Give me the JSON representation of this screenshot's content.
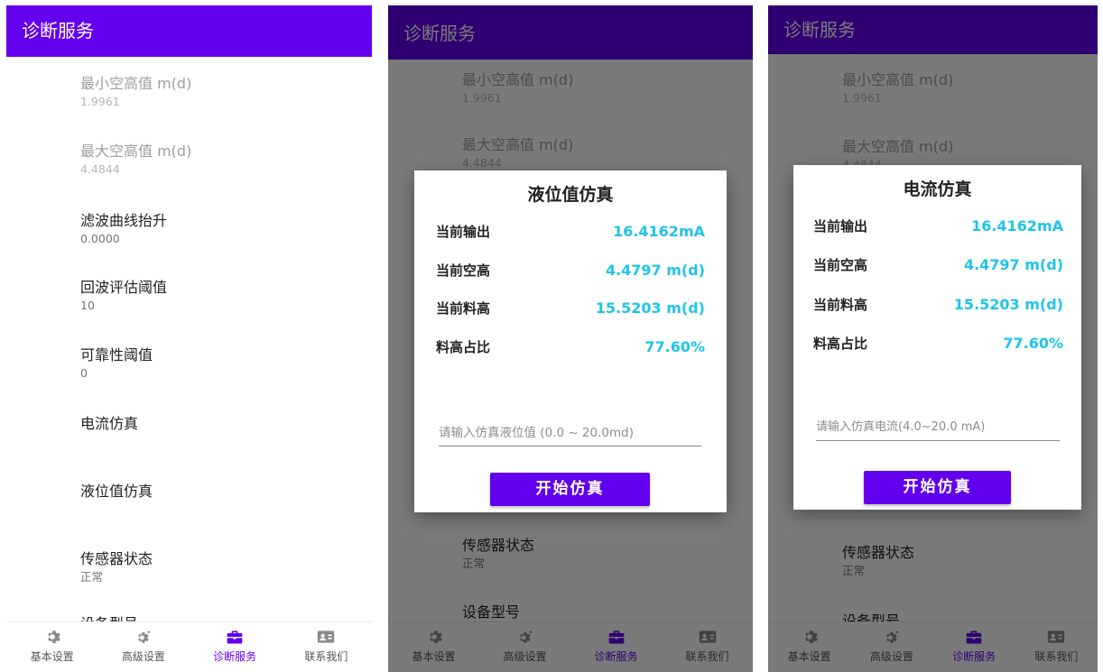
{
  "appbar": {
    "title": "诊断服务"
  },
  "settings": [
    {
      "title": "最小空高值 m(d)",
      "value": "1.9961"
    },
    {
      "title": "最大空高值 m(d)",
      "value": "4.4844"
    },
    {
      "title": "滤波曲线抬升",
      "value": "0.0000"
    },
    {
      "title": "回波评估阈值",
      "value": "10"
    },
    {
      "title": "可靠性阈值",
      "value": "0"
    },
    {
      "title": "电流仿真",
      "value": ""
    },
    {
      "title": "液位值仿真",
      "value": ""
    },
    {
      "title": "传感器状态",
      "value": "正常"
    },
    {
      "title": "设备型号",
      "value": ""
    }
  ],
  "nav": [
    {
      "label": "基本设置",
      "icon": "gear-icon"
    },
    {
      "label": "高级设置",
      "icon": "advanced-gear-icon"
    },
    {
      "label": "诊断服务",
      "icon": "toolbox-icon"
    },
    {
      "label": "联系我们",
      "icon": "contact-card-icon"
    }
  ],
  "dialog_level": {
    "title": "液位值仿真",
    "rows": [
      {
        "label": "当前输出",
        "value": "16.4162mA"
      },
      {
        "label": "当前空高",
        "value": "4.4797 m(d)"
      },
      {
        "label": "当前料高",
        "value": "15.5203 m(d)"
      },
      {
        "label": "料高占比",
        "value": "77.60%"
      }
    ],
    "input_placeholder": "请输入仿真液位值 (0.0 ~ 20.0md)",
    "button": "开始仿真"
  },
  "dialog_current": {
    "title": "电流仿真",
    "rows": [
      {
        "label": "当前输出",
        "value": "16.4162mA"
      },
      {
        "label": "当前空高",
        "value": "4.4797 m(d)"
      },
      {
        "label": "当前料高",
        "value": "15.5203 m(d)"
      },
      {
        "label": "料高占比",
        "value": "77.60%"
      }
    ],
    "input_placeholder": "请输入仿真电流(4.0~20.0 mA)",
    "button": "开始仿真"
  },
  "colors": {
    "primary": "#6200ee",
    "value_accent": "#1ec4ea",
    "nav_active": "#6200ee"
  }
}
